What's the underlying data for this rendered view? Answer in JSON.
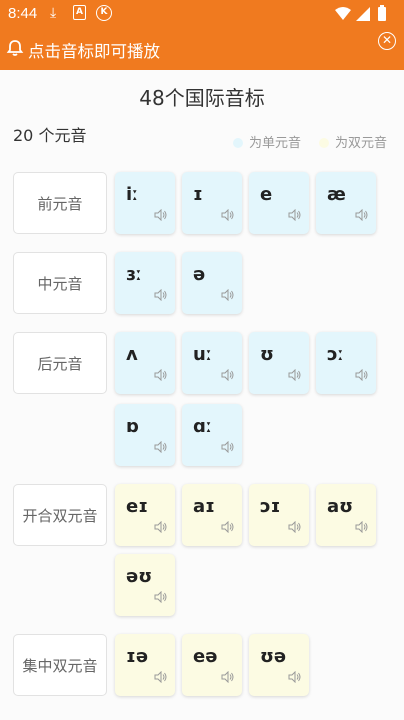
{
  "status_bar": {
    "time": "8:44",
    "icons": [
      "download-icon",
      "a-badge-icon",
      "k-badge-icon",
      "wifi-icon",
      "signal-icon",
      "battery-icon"
    ]
  },
  "banner": {
    "text": "点击音标即可播放",
    "icons": [
      "bell-icon",
      "close-icon"
    ]
  },
  "title": "48个国际音标",
  "count_label": "20 个元音",
  "legend": {
    "mono": "为单元音",
    "diph": "为双元音"
  },
  "colors": {
    "accent": "#f07a1f",
    "mono_bg": "#e3f6fc",
    "diph_bg": "#fcfbe3",
    "mono_dot": "#e3f6fc",
    "diph_dot": "#fcfbe3"
  },
  "categories": [
    {
      "label": "前元音",
      "symbols": [
        "iː",
        "ɪ",
        "e",
        "æ"
      ]
    },
    {
      "label": "中元音",
      "symbols": [
        "ɜː",
        "ə"
      ]
    },
    {
      "label": "后元音",
      "symbols": [
        "ʌ",
        "uː",
        "ʊ",
        "ɔː",
        "ɒ",
        "ɑː"
      ]
    },
    {
      "label": "开合双元音",
      "symbols": [
        "eɪ",
        "aɪ",
        "ɔɪ",
        "aʊ",
        "əʊ"
      ]
    },
    {
      "label": "集中双元音",
      "symbols": [
        "ɪə",
        "eə",
        "ʊə"
      ]
    }
  ]
}
